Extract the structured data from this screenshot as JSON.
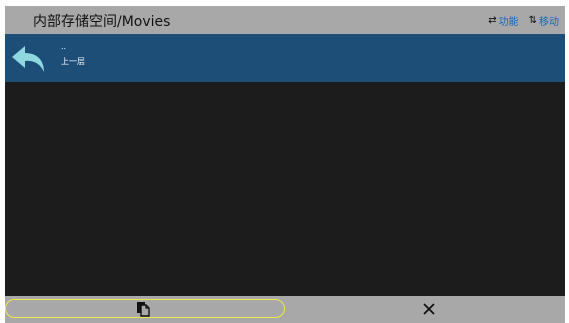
{
  "header": {
    "path_title": "内部存储空间/Movies",
    "actions": [
      {
        "icon": "swap-horizontal-icon",
        "label": "功能"
      },
      {
        "icon": "swap-vertical-icon",
        "label": "移动"
      }
    ]
  },
  "parent_row": {
    "icon": "back-arrow-icon",
    "dots": "..",
    "label": "上一层"
  },
  "bottom_bar": {
    "paste_icon": "paste-icon",
    "close_icon": "close-icon"
  },
  "colors": {
    "title_bar": "#a8a8a8",
    "row_highlight": "#1d4e78",
    "background": "#1c1c1c",
    "accent_icon": "#8fd8e0",
    "focus_outline": "#f0e84a",
    "action_text": "#1565c0"
  }
}
